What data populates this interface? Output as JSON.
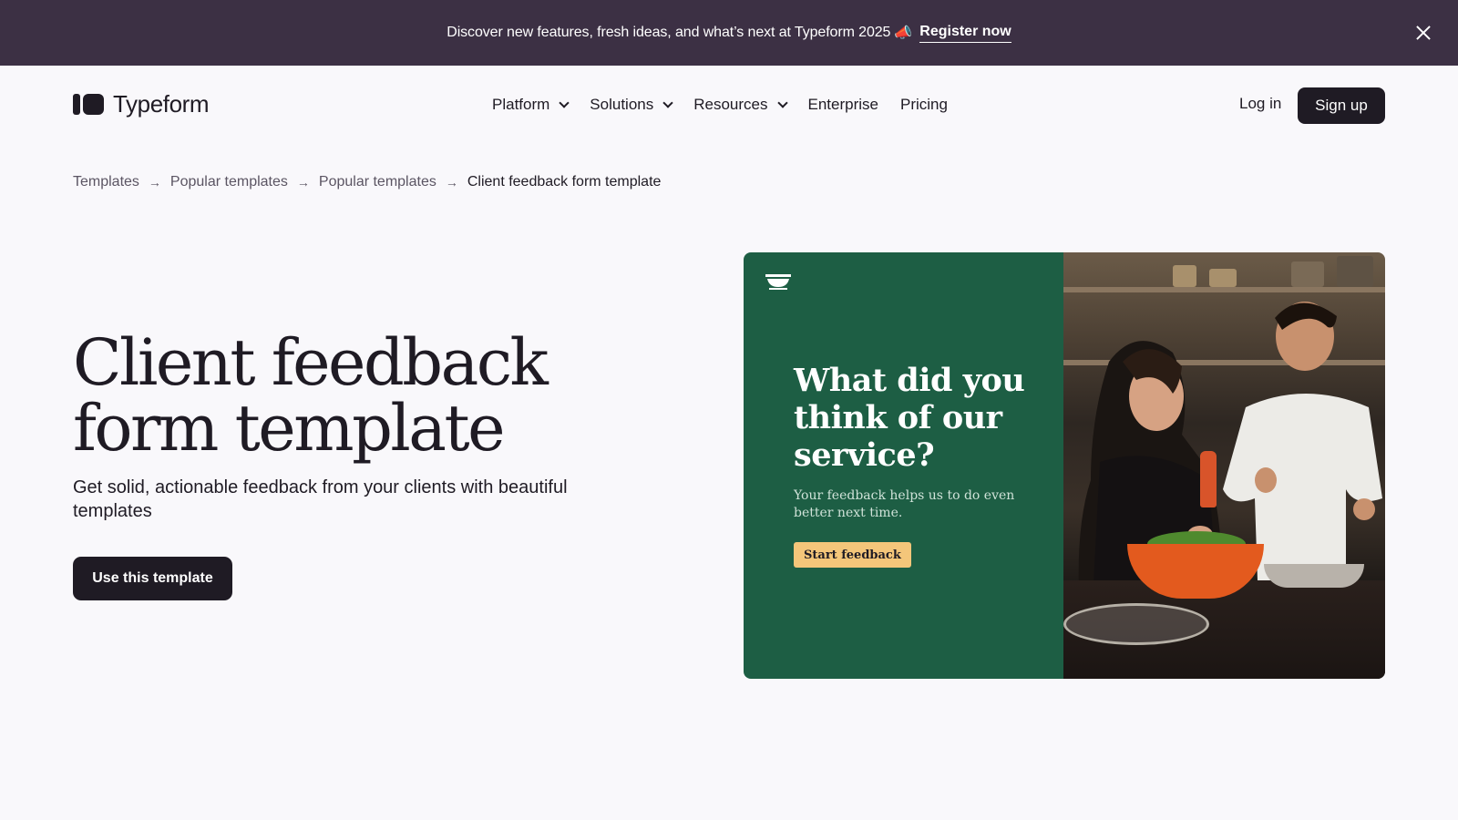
{
  "banner": {
    "message": "Discover new features, fresh ideas, and what’s next at Typeform 2025",
    "emoji": "📣",
    "link_label": "Register now",
    "close_icon": "close-icon"
  },
  "header": {
    "logo_text": "Typeform",
    "nav": [
      {
        "label": "Platform",
        "has_dropdown": true
      },
      {
        "label": "Solutions",
        "has_dropdown": true
      },
      {
        "label": "Resources",
        "has_dropdown": true
      },
      {
        "label": "Enterprise",
        "has_dropdown": false
      },
      {
        "label": "Pricing",
        "has_dropdown": false
      }
    ],
    "login_label": "Log in",
    "signup_label": "Sign up"
  },
  "breadcrumb": {
    "items": [
      "Templates",
      "Popular templates",
      "Popular templates",
      "Client feedback form template"
    ],
    "separator": "→"
  },
  "hero": {
    "title": "Client feedback form template",
    "subtitle": "Get solid, actionable feedback from your clients with beautiful templates",
    "cta_label": "Use this template"
  },
  "preview": {
    "question": "What did you think of our service?",
    "description": "Your feedback helps us to do even better next time.",
    "button_label": "Start feedback",
    "colors": {
      "panel": "#1d5e44",
      "button": "#f4c67a"
    }
  },
  "colors": {
    "banner_bg": "#3c3044",
    "page_bg": "#f9f8fb",
    "primary": "#1f1b24"
  }
}
